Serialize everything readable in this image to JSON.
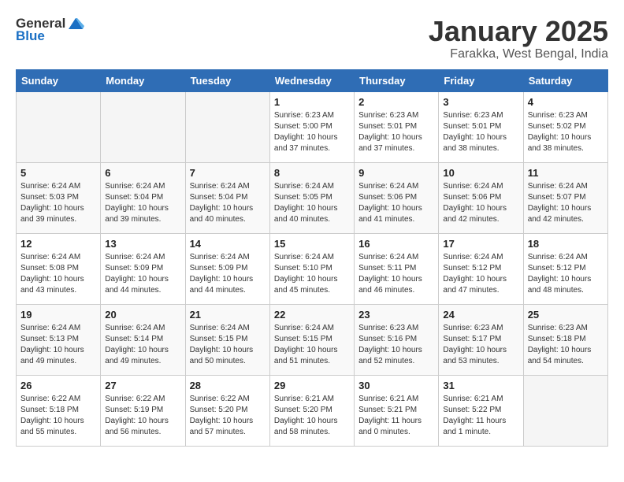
{
  "header": {
    "logo_general": "General",
    "logo_blue": "Blue",
    "title": "January 2025",
    "subtitle": "Farakka, West Bengal, India"
  },
  "weekdays": [
    "Sunday",
    "Monday",
    "Tuesday",
    "Wednesday",
    "Thursday",
    "Friday",
    "Saturday"
  ],
  "weeks": [
    [
      {
        "day": "",
        "empty": true
      },
      {
        "day": "",
        "empty": true
      },
      {
        "day": "",
        "empty": true
      },
      {
        "day": "1",
        "sunrise": "Sunrise: 6:23 AM",
        "sunset": "Sunset: 5:00 PM",
        "daylight": "Daylight: 10 hours and 37 minutes."
      },
      {
        "day": "2",
        "sunrise": "Sunrise: 6:23 AM",
        "sunset": "Sunset: 5:01 PM",
        "daylight": "Daylight: 10 hours and 37 minutes."
      },
      {
        "day": "3",
        "sunrise": "Sunrise: 6:23 AM",
        "sunset": "Sunset: 5:01 PM",
        "daylight": "Daylight: 10 hours and 38 minutes."
      },
      {
        "day": "4",
        "sunrise": "Sunrise: 6:23 AM",
        "sunset": "Sunset: 5:02 PM",
        "daylight": "Daylight: 10 hours and 38 minutes."
      }
    ],
    [
      {
        "day": "5",
        "sunrise": "Sunrise: 6:24 AM",
        "sunset": "Sunset: 5:03 PM",
        "daylight": "Daylight: 10 hours and 39 minutes."
      },
      {
        "day": "6",
        "sunrise": "Sunrise: 6:24 AM",
        "sunset": "Sunset: 5:04 PM",
        "daylight": "Daylight: 10 hours and 39 minutes."
      },
      {
        "day": "7",
        "sunrise": "Sunrise: 6:24 AM",
        "sunset": "Sunset: 5:04 PM",
        "daylight": "Daylight: 10 hours and 40 minutes."
      },
      {
        "day": "8",
        "sunrise": "Sunrise: 6:24 AM",
        "sunset": "Sunset: 5:05 PM",
        "daylight": "Daylight: 10 hours and 40 minutes."
      },
      {
        "day": "9",
        "sunrise": "Sunrise: 6:24 AM",
        "sunset": "Sunset: 5:06 PM",
        "daylight": "Daylight: 10 hours and 41 minutes."
      },
      {
        "day": "10",
        "sunrise": "Sunrise: 6:24 AM",
        "sunset": "Sunset: 5:06 PM",
        "daylight": "Daylight: 10 hours and 42 minutes."
      },
      {
        "day": "11",
        "sunrise": "Sunrise: 6:24 AM",
        "sunset": "Sunset: 5:07 PM",
        "daylight": "Daylight: 10 hours and 42 minutes."
      }
    ],
    [
      {
        "day": "12",
        "sunrise": "Sunrise: 6:24 AM",
        "sunset": "Sunset: 5:08 PM",
        "daylight": "Daylight: 10 hours and 43 minutes."
      },
      {
        "day": "13",
        "sunrise": "Sunrise: 6:24 AM",
        "sunset": "Sunset: 5:09 PM",
        "daylight": "Daylight: 10 hours and 44 minutes."
      },
      {
        "day": "14",
        "sunrise": "Sunrise: 6:24 AM",
        "sunset": "Sunset: 5:09 PM",
        "daylight": "Daylight: 10 hours and 44 minutes."
      },
      {
        "day": "15",
        "sunrise": "Sunrise: 6:24 AM",
        "sunset": "Sunset: 5:10 PM",
        "daylight": "Daylight: 10 hours and 45 minutes."
      },
      {
        "day": "16",
        "sunrise": "Sunrise: 6:24 AM",
        "sunset": "Sunset: 5:11 PM",
        "daylight": "Daylight: 10 hours and 46 minutes."
      },
      {
        "day": "17",
        "sunrise": "Sunrise: 6:24 AM",
        "sunset": "Sunset: 5:12 PM",
        "daylight": "Daylight: 10 hours and 47 minutes."
      },
      {
        "day": "18",
        "sunrise": "Sunrise: 6:24 AM",
        "sunset": "Sunset: 5:12 PM",
        "daylight": "Daylight: 10 hours and 48 minutes."
      }
    ],
    [
      {
        "day": "19",
        "sunrise": "Sunrise: 6:24 AM",
        "sunset": "Sunset: 5:13 PM",
        "daylight": "Daylight: 10 hours and 49 minutes."
      },
      {
        "day": "20",
        "sunrise": "Sunrise: 6:24 AM",
        "sunset": "Sunset: 5:14 PM",
        "daylight": "Daylight: 10 hours and 49 minutes."
      },
      {
        "day": "21",
        "sunrise": "Sunrise: 6:24 AM",
        "sunset": "Sunset: 5:15 PM",
        "daylight": "Daylight: 10 hours and 50 minutes."
      },
      {
        "day": "22",
        "sunrise": "Sunrise: 6:24 AM",
        "sunset": "Sunset: 5:15 PM",
        "daylight": "Daylight: 10 hours and 51 minutes."
      },
      {
        "day": "23",
        "sunrise": "Sunrise: 6:23 AM",
        "sunset": "Sunset: 5:16 PM",
        "daylight": "Daylight: 10 hours and 52 minutes."
      },
      {
        "day": "24",
        "sunrise": "Sunrise: 6:23 AM",
        "sunset": "Sunset: 5:17 PM",
        "daylight": "Daylight: 10 hours and 53 minutes."
      },
      {
        "day": "25",
        "sunrise": "Sunrise: 6:23 AM",
        "sunset": "Sunset: 5:18 PM",
        "daylight": "Daylight: 10 hours and 54 minutes."
      }
    ],
    [
      {
        "day": "26",
        "sunrise": "Sunrise: 6:22 AM",
        "sunset": "Sunset: 5:18 PM",
        "daylight": "Daylight: 10 hours and 55 minutes."
      },
      {
        "day": "27",
        "sunrise": "Sunrise: 6:22 AM",
        "sunset": "Sunset: 5:19 PM",
        "daylight": "Daylight: 10 hours and 56 minutes."
      },
      {
        "day": "28",
        "sunrise": "Sunrise: 6:22 AM",
        "sunset": "Sunset: 5:20 PM",
        "daylight": "Daylight: 10 hours and 57 minutes."
      },
      {
        "day": "29",
        "sunrise": "Sunrise: 6:21 AM",
        "sunset": "Sunset: 5:20 PM",
        "daylight": "Daylight: 10 hours and 58 minutes."
      },
      {
        "day": "30",
        "sunrise": "Sunrise: 6:21 AM",
        "sunset": "Sunset: 5:21 PM",
        "daylight": "Daylight: 11 hours and 0 minutes."
      },
      {
        "day": "31",
        "sunrise": "Sunrise: 6:21 AM",
        "sunset": "Sunset: 5:22 PM",
        "daylight": "Daylight: 11 hours and 1 minute."
      },
      {
        "day": "",
        "empty": true
      }
    ]
  ]
}
